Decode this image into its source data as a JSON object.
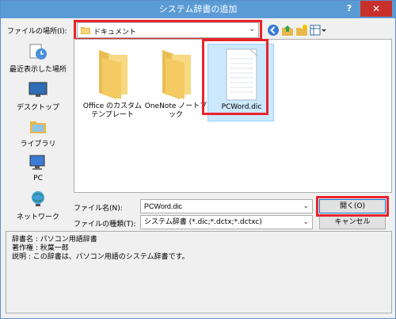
{
  "window": {
    "title": "システム辞書の追加",
    "help_glyph": "?",
    "close_glyph": "✕"
  },
  "location": {
    "label": "ファイルの場所(I):",
    "value": "ドキュメント"
  },
  "places": [
    {
      "label": "最近表示した場所",
      "icon": "recent-places-icon"
    },
    {
      "label": "デスクトップ",
      "icon": "desktop-icon"
    },
    {
      "label": "ライブラリ",
      "icon": "libraries-icon"
    },
    {
      "label": "PC",
      "icon": "pc-icon"
    },
    {
      "label": "ネットワーク",
      "icon": "network-icon"
    }
  ],
  "files": [
    {
      "name": "Office のカスタム テンプレート",
      "type": "folder"
    },
    {
      "name": "OneNote ノートブック",
      "type": "folder"
    },
    {
      "name": "PCWord.dic",
      "type": "document",
      "selected": true
    }
  ],
  "filename": {
    "label": "ファイル名(N):",
    "value": "PCWord.dic"
  },
  "filetype": {
    "label": "ファイルの種類(T):",
    "value": "システム辞書 (*.dic;*.dctx;*.dctxc)"
  },
  "buttons": {
    "open": "開く(O)",
    "cancel": "キャンセル"
  },
  "info": {
    "line1": "辞書名 : パソコン用語辞書",
    "line2": "著作権 : 秋葉一郎",
    "line3": "説明 : この辞書は、パソコン用語のシステム辞書です。"
  },
  "colors": {
    "titlebar": "#5b9bd5",
    "close": "#c8302b",
    "highlight_frame": "#e8242c",
    "selection": "#cce8ff"
  }
}
